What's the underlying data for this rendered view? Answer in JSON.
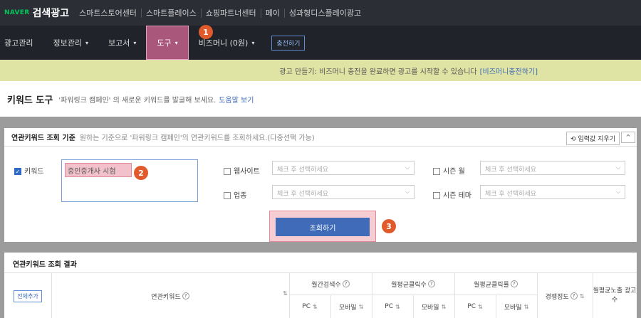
{
  "topbar": {
    "logo": "NAVER",
    "brand": "검색광고",
    "links": [
      "스마트스토어센터",
      "스마트플레이스",
      "쇼핑파트너센터",
      "페이",
      "성과형디스플레이광고"
    ]
  },
  "menu": {
    "items": [
      {
        "label": "광고관리",
        "chev": ""
      },
      {
        "label": "정보관리",
        "chev": "▾"
      },
      {
        "label": "보고서",
        "chev": "▾"
      },
      {
        "label": "도구",
        "chev": "▾"
      },
      {
        "label": "비즈머니 (0원)",
        "chev": "▾"
      }
    ],
    "charge_label": "충전하기"
  },
  "notice": {
    "text": "광고 만들기: 비즈머니 충전을 완료하면 광고를 시작할 수 있습니다",
    "link": "[비즈머니충전하기]"
  },
  "title": {
    "heading": "키워드 도구",
    "desc": "'파워링크 캠페인' 의 새로운 키워드를 발굴해 보세요.",
    "link": "도움말 보기"
  },
  "criteria": {
    "title": "연관키워드 조회 기준",
    "desc": "원하는 기준으로 '파워링크 캠페인'의 연관키워드를 조회하세요.(다중선택 가능)",
    "reset_label": "입력값 지우기",
    "collapse_label": "^",
    "keyword_label": "키워드",
    "keyword_value": "중인중개사 시험",
    "website_label": "웹사이트",
    "season_month_label": "시즌 월",
    "industry_label": "업종",
    "season_theme_label": "시즌 테마",
    "select_placeholder": "체크 후 선택하세요",
    "search_label": "조회하기"
  },
  "results": {
    "title": "연관키워드 조회 결과",
    "add_all_label": "전체추가",
    "col_keyword": "연관키워드",
    "col_monthly_search": "월간검색수",
    "col_avg_clicks": "월평균클릭수",
    "col_avg_ctr": "월평균클릭률",
    "col_competition": "경쟁정도",
    "col_avg_ad_exposure": "월평균노출 광고수",
    "sub_pc": "PC",
    "sub_mobile": "모바일"
  },
  "badges": [
    "1",
    "2",
    "3"
  ]
}
